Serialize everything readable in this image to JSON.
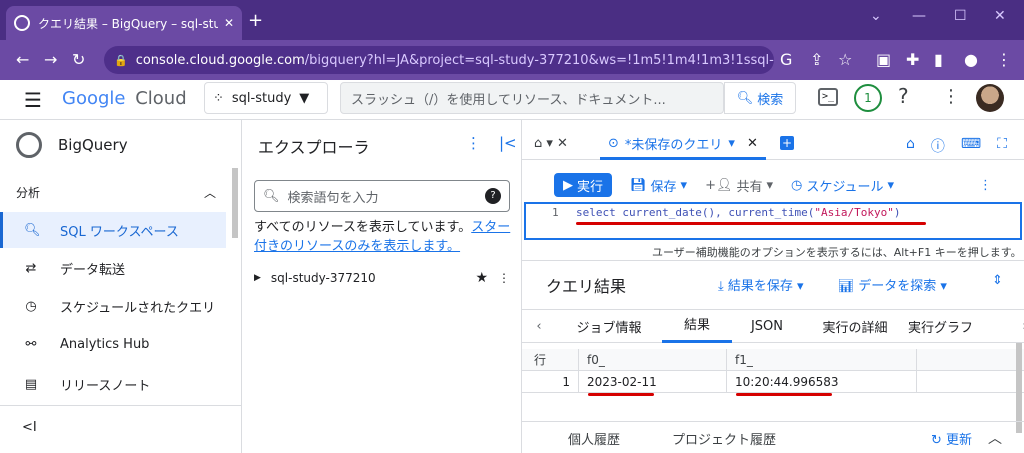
{
  "browser": {
    "tab_title": "クエリ結果 – BigQuery – sql-study",
    "tab_close": "✕",
    "new_tab": "+",
    "url_host": "console.cloud.google.com",
    "url_path": "/bigquery?hl=JA&project=sql-study-377210&ws=!1m5!1m4!1m3!1ssql-study-37...",
    "win_min": "—",
    "win_max": "☐",
    "win_close": "✕"
  },
  "header": {
    "logo_text": "Google",
    "logo_cloud": "Cloud",
    "project": "sql-study",
    "search_placeholder": "スラッシュ（/）を使用してリソース、ドキュメント...",
    "search_button": "検索",
    "notification_count": "1"
  },
  "leftnav": {
    "title": "BigQuery",
    "section": "分析",
    "items": [
      {
        "label": "SQL ワークスペース",
        "icon": "search-icon",
        "active": true
      },
      {
        "label": "データ転送",
        "icon": "transfer-icon",
        "active": false
      },
      {
        "label": "スケジュールされたクエリ",
        "icon": "clock-icon",
        "active": false
      },
      {
        "label": "Analytics Hub",
        "icon": "hub-icon",
        "active": false
      },
      {
        "label": "リリースノート",
        "icon": "notes-icon",
        "active": false
      }
    ],
    "collapse": "<I"
  },
  "explorer": {
    "title": "エクスプローラ",
    "search_placeholder": "検索語句を入力",
    "message": "すべてのリソースを表示しています。",
    "message_link": "スター付きのリソースのみを表示します。",
    "project": "sql-study-377210"
  },
  "editor": {
    "tab_label": "*未保存のクエリ",
    "toolbar": {
      "run": "実行",
      "save": "保存",
      "share": "共有",
      "schedule": "スケジュール"
    },
    "line_number": "1",
    "code_prefix": "select current_date(), current_time(",
    "code_string": "\"Asia/Tokyo\"",
    "code_suffix": ")",
    "a11y_hint": "ユーザー補助機能のオプションを表示するには、Alt+F1 キーを押します。"
  },
  "results": {
    "title": "クエリ結果",
    "save_results": "結果を保存",
    "explore_data": "データを探索",
    "tabs": [
      "ジョブ情報",
      "結果",
      "JSON",
      "実行の詳細",
      "実行グラフ"
    ],
    "columns": [
      "行",
      "f0_",
      "f1_"
    ],
    "rows": [
      {
        "row": "1",
        "f0": "2023-02-11",
        "f1": "10:20:44.996583"
      }
    ],
    "bottom": {
      "personal_history": "個人履歴",
      "project_history": "プロジェクト履歴",
      "refresh": "更新"
    }
  },
  "colors": {
    "chrome": "#4a2e83",
    "accent": "#1a73e8",
    "annotation": "#d50000"
  }
}
